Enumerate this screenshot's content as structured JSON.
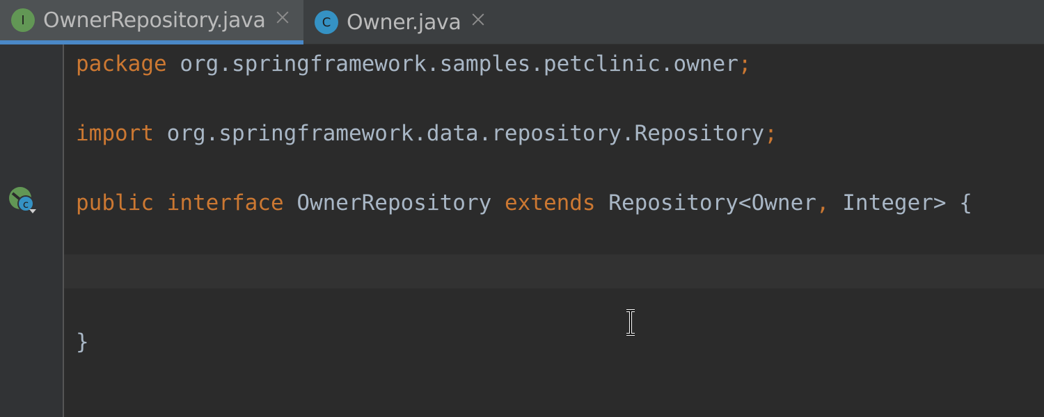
{
  "tabs": [
    {
      "label": "OwnerRepository.java",
      "icon_letter": "I",
      "icon_color": "#629755",
      "active": true
    },
    {
      "label": "Owner.java",
      "icon_letter": "C",
      "icon_color": "#3592c4",
      "active": false
    }
  ],
  "code": {
    "line1": {
      "kw": "package",
      "rest": "org.springframework.samples.petclinic.owner",
      "semi": ";"
    },
    "line2": {
      "kw": "import",
      "rest": "org.springframework.data.repository.Repository",
      "semi": ";"
    },
    "line3": {
      "kw_public": "public",
      "kw_interface": "interface",
      "name": "OwnerRepository",
      "kw_extends": "extends",
      "type": "Repository<Owner",
      "comma": ",",
      "type2": "Integer>",
      "brace": "{"
    },
    "line4": {
      "brace": "}"
    }
  },
  "colors": {
    "keyword": "#cc7832",
    "identifier": "#a9b7c6",
    "background": "#2b2b2b",
    "tab_active_underline": "#4a88c7"
  },
  "icons": {
    "gutter": "implemented-by-class-icon",
    "cursor": "text-cursor-icon"
  }
}
